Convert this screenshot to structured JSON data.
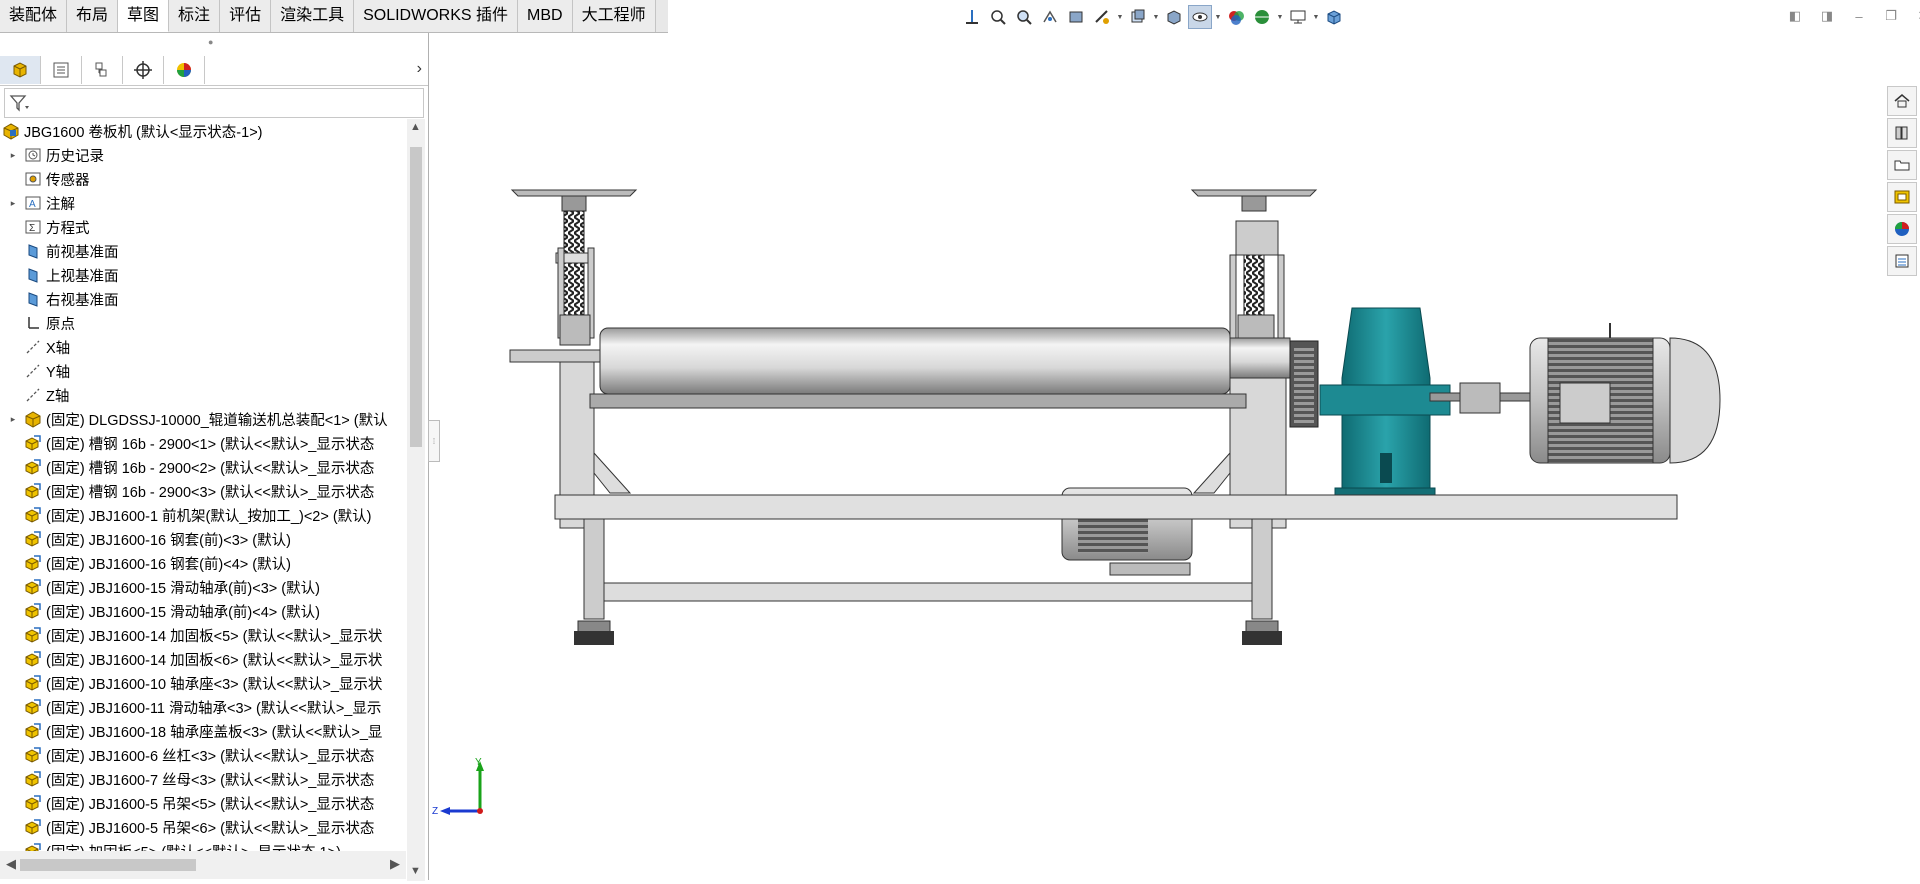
{
  "tabs": [
    {
      "label": "装配体",
      "active": false
    },
    {
      "label": "布局",
      "active": false
    },
    {
      "label": "草图",
      "active": true
    },
    {
      "label": "标注",
      "active": false
    },
    {
      "label": "评估",
      "active": false
    },
    {
      "label": "渲染工具",
      "active": false
    },
    {
      "label": "SOLIDWORKS 插件",
      "active": false
    },
    {
      "label": "MBD",
      "active": false
    },
    {
      "label": "大工程师",
      "active": false
    }
  ],
  "heads_up_icons": [
    "view-orientation-icon",
    "zoom-to-fit-icon",
    "zoom-to-area-icon",
    "previous-view-icon",
    "section-view-icon",
    "dynamic-annotation-icon",
    "view-settings-icon",
    "display-style-icon",
    "hide-show-items-icon",
    "edit-appearance-icon",
    "apply-scene-icon",
    "view-display-icon",
    "cube-view-icon"
  ],
  "panel_tabs": [
    "feature-manager-icon",
    "property-manager-icon",
    "configuration-manager-icon",
    "dim-xpert-icon",
    "display-manager-icon"
  ],
  "tree": [
    {
      "label": "JBG1600 卷板机  (默认<显示状态-1>)",
      "icon": "assembly-icon",
      "expander": "",
      "indent": 0
    },
    {
      "label": "历史记录",
      "icon": "history-icon",
      "expander": "▸",
      "indent": 1
    },
    {
      "label": "传感器",
      "icon": "sensor-icon",
      "expander": "",
      "indent": 1
    },
    {
      "label": "注解",
      "icon": "annotation-icon",
      "expander": "▸",
      "indent": 1
    },
    {
      "label": "方程式",
      "icon": "equation-icon",
      "expander": "",
      "indent": 1
    },
    {
      "label": "前视基准面",
      "icon": "plane-icon",
      "expander": "",
      "indent": 1
    },
    {
      "label": "上视基准面",
      "icon": "plane-icon",
      "expander": "",
      "indent": 1
    },
    {
      "label": "右视基准面",
      "icon": "plane-icon",
      "expander": "",
      "indent": 1
    },
    {
      "label": "原点",
      "icon": "origin-icon",
      "expander": "",
      "indent": 1
    },
    {
      "label": "X轴",
      "icon": "axis-icon",
      "expander": "",
      "indent": 1
    },
    {
      "label": "Y轴",
      "icon": "axis-icon",
      "expander": "",
      "indent": 1
    },
    {
      "label": "Z轴",
      "icon": "axis-icon",
      "expander": "",
      "indent": 1
    },
    {
      "label": "(固定) DLGDSSJ-10000_辊道输送机总装配<1> (默认",
      "icon": "subassembly-icon",
      "expander": "▸",
      "indent": 1
    },
    {
      "label": "(固定) 槽钢 16b - 2900<1> (默认<<默认>_显示状态",
      "icon": "part-icon",
      "expander": "",
      "indent": 1
    },
    {
      "label": "(固定) 槽钢 16b - 2900<2> (默认<<默认>_显示状态",
      "icon": "part-icon",
      "expander": "",
      "indent": 1
    },
    {
      "label": "(固定) 槽钢 16b - 2900<3> (默认<<默认>_显示状态",
      "icon": "part-icon",
      "expander": "",
      "indent": 1
    },
    {
      "label": "(固定) JBJ1600-1 前机架(默认_按加工_)<2> (默认)",
      "icon": "part-icon",
      "expander": "",
      "indent": 1
    },
    {
      "label": "(固定) JBJ1600-16 钢套(前)<3> (默认)",
      "icon": "part-icon",
      "expander": "",
      "indent": 1
    },
    {
      "label": "(固定) JBJ1600-16 钢套(前)<4> (默认)",
      "icon": "part-icon",
      "expander": "",
      "indent": 1
    },
    {
      "label": "(固定) JBJ1600-15 滑动轴承(前)<3> (默认)",
      "icon": "part-icon",
      "expander": "",
      "indent": 1
    },
    {
      "label": "(固定) JBJ1600-15 滑动轴承(前)<4> (默认)",
      "icon": "part-icon",
      "expander": "",
      "indent": 1
    },
    {
      "label": "(固定) JBJ1600-14 加固板<5> (默认<<默认>_显示状",
      "icon": "part-icon",
      "expander": "",
      "indent": 1
    },
    {
      "label": "(固定) JBJ1600-14 加固板<6> (默认<<默认>_显示状",
      "icon": "part-icon",
      "expander": "",
      "indent": 1
    },
    {
      "label": "(固定) JBJ1600-10 轴承座<3> (默认<<默认>_显示状",
      "icon": "part-icon",
      "expander": "",
      "indent": 1
    },
    {
      "label": "(固定) JBJ1600-11 滑动轴承<3> (默认<<默认>_显示",
      "icon": "part-icon",
      "expander": "",
      "indent": 1
    },
    {
      "label": "(固定) JBJ1600-18 轴承座盖板<3> (默认<<默认>_显",
      "icon": "part-icon",
      "expander": "",
      "indent": 1
    },
    {
      "label": "(固定) JBJ1600-6 丝杠<3> (默认<<默认>_显示状态",
      "icon": "part-icon",
      "expander": "",
      "indent": 1
    },
    {
      "label": "(固定) JBJ1600-7 丝母<3> (默认<<默认>_显示状态",
      "icon": "part-icon",
      "expander": "",
      "indent": 1
    },
    {
      "label": "(固定) JBJ1600-5 吊架<5> (默认<<默认>_显示状态",
      "icon": "part-icon",
      "expander": "",
      "indent": 1
    },
    {
      "label": "(固定) JBJ1600-5 吊架<6> (默认<<默认>_显示状态",
      "icon": "part-icon",
      "expander": "",
      "indent": 1
    },
    {
      "label": "(固定) 加固板<5> (默认<<默认>_显示状态 1>)",
      "icon": "part-icon",
      "expander": "",
      "indent": 1
    }
  ],
  "task_pane_icons": [
    "home-icon",
    "design-library-icon",
    "file-explorer-icon",
    "view-palette-icon",
    "appearances-icon",
    "custom-properties-icon"
  ],
  "triad": {
    "x_label": "",
    "y_label": "Y",
    "z_label": "Z"
  },
  "colors": {
    "teal": "#1f8f96",
    "accent": "#2a6fc0",
    "steel": "#c8c8c8"
  }
}
